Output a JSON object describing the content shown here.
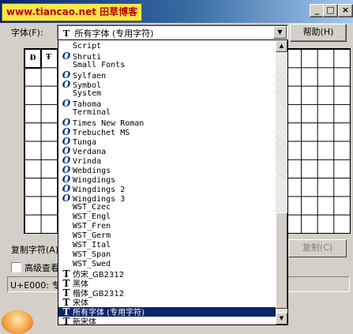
{
  "titlebar": {
    "site_banner": "www.tiancao.net 田草博客",
    "minimize": "_",
    "maximize": "□",
    "close": "×"
  },
  "font_row": {
    "label": "字体(F):",
    "selected": "所有字体 (专用字符)",
    "help_label": "帮助(H)"
  },
  "grid": {
    "first_cell": "Ð",
    "second_cell": "Ŧ"
  },
  "copy_row": {
    "label": "复制字符(A):",
    "copy_button": "复制(C)"
  },
  "advanced": {
    "label": "高级查看"
  },
  "statusbar": {
    "text": "U+E000: 专"
  },
  "dropdown": {
    "items": [
      {
        "label": "Script",
        "icon": ""
      },
      {
        "label": "Shruti",
        "icon": "O"
      },
      {
        "label": "Small Fonts",
        "icon": ""
      },
      {
        "label": "Sylfaen",
        "icon": "O"
      },
      {
        "label": "Symbol",
        "icon": "O"
      },
      {
        "label": "System",
        "icon": ""
      },
      {
        "label": "Tahoma",
        "icon": "O"
      },
      {
        "label": "Terminal",
        "icon": ""
      },
      {
        "label": "Times New Roman",
        "icon": "O"
      },
      {
        "label": "Trebuchet MS",
        "icon": "O"
      },
      {
        "label": "Tunga",
        "icon": "O"
      },
      {
        "label": "Verdana",
        "icon": "O"
      },
      {
        "label": "Vrinda",
        "icon": "O"
      },
      {
        "label": "Webdings",
        "icon": "O"
      },
      {
        "label": "Wingdings",
        "icon": "O"
      },
      {
        "label": "Wingdings 2",
        "icon": "O"
      },
      {
        "label": "Wingdings 3",
        "icon": "O"
      },
      {
        "label": "WST_Czec",
        "icon": ""
      },
      {
        "label": "WST_Engl",
        "icon": ""
      },
      {
        "label": "WST_Fren",
        "icon": ""
      },
      {
        "label": "WST_Germ",
        "icon": ""
      },
      {
        "label": "WST_Ital",
        "icon": ""
      },
      {
        "label": "WST_Span",
        "icon": ""
      },
      {
        "label": "WST_Swed",
        "icon": ""
      },
      {
        "label": "仿宋_GB2312",
        "icon": "T"
      },
      {
        "label": "黑体",
        "icon": "T"
      },
      {
        "label": "楷体_GB2312",
        "icon": "T"
      },
      {
        "label": "宋体",
        "icon": "T"
      },
      {
        "label": "所有字体 (专用字符)",
        "icon": "T"
      },
      {
        "label": "新宋体",
        "icon": "T"
      }
    ],
    "selected_index": 28
  }
}
